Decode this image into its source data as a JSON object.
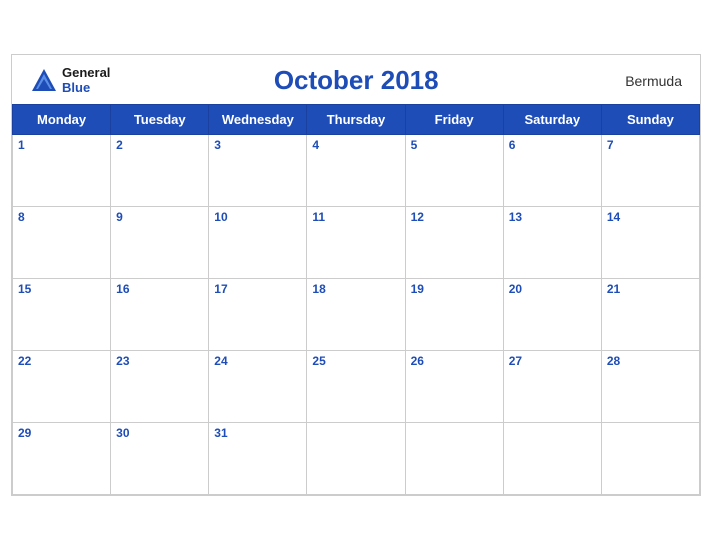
{
  "header": {
    "logo_general": "General",
    "logo_blue": "Blue",
    "title": "October 2018",
    "region": "Bermuda"
  },
  "weekdays": [
    "Monday",
    "Tuesday",
    "Wednesday",
    "Thursday",
    "Friday",
    "Saturday",
    "Sunday"
  ],
  "weeks": [
    [
      {
        "day": "1"
      },
      {
        "day": "2"
      },
      {
        "day": "3"
      },
      {
        "day": "4"
      },
      {
        "day": "5"
      },
      {
        "day": "6"
      },
      {
        "day": "7"
      }
    ],
    [
      {
        "day": "8"
      },
      {
        "day": "9"
      },
      {
        "day": "10"
      },
      {
        "day": "11"
      },
      {
        "day": "12"
      },
      {
        "day": "13"
      },
      {
        "day": "14"
      }
    ],
    [
      {
        "day": "15"
      },
      {
        "day": "16"
      },
      {
        "day": "17"
      },
      {
        "day": "18"
      },
      {
        "day": "19"
      },
      {
        "day": "20"
      },
      {
        "day": "21"
      }
    ],
    [
      {
        "day": "22"
      },
      {
        "day": "23"
      },
      {
        "day": "24"
      },
      {
        "day": "25"
      },
      {
        "day": "26"
      },
      {
        "day": "27"
      },
      {
        "day": "28"
      }
    ],
    [
      {
        "day": "29"
      },
      {
        "day": "30"
      },
      {
        "day": "31"
      },
      {
        "day": ""
      },
      {
        "day": ""
      },
      {
        "day": ""
      },
      {
        "day": ""
      }
    ]
  ],
  "colors": {
    "header_bg": "#1e4db7",
    "accent": "#1e4db7"
  }
}
